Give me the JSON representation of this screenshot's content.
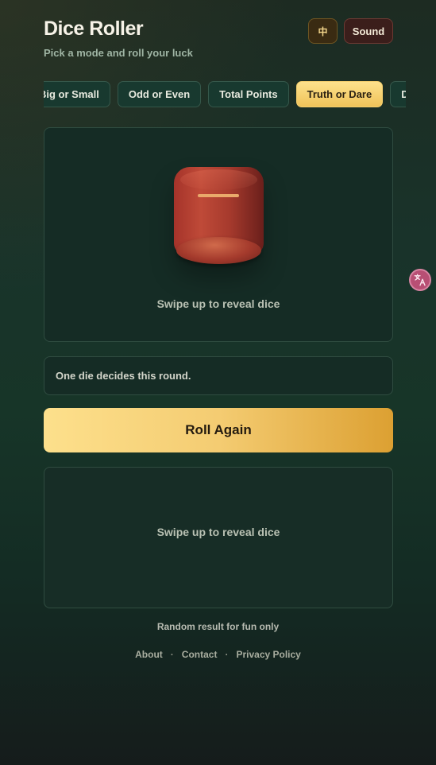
{
  "header": {
    "title": "Dice Roller",
    "subtitle": "Pick a mode and roll your luck",
    "language_label": "中",
    "sound_label": "Sound"
  },
  "modes": [
    {
      "label": "Big or Small",
      "active": false
    },
    {
      "label": "Odd or Even",
      "active": false
    },
    {
      "label": "Total Points",
      "active": false
    },
    {
      "label": "Truth or Dare",
      "active": true
    },
    {
      "label": "Dare",
      "active": false
    }
  ],
  "stage": {
    "hint": "Swipe up to reveal dice"
  },
  "info": {
    "text": "One die decides this round."
  },
  "roll_button": {
    "label": "Roll Again"
  },
  "reveal": {
    "hint": "Swipe up to reveal dice"
  },
  "disclaimer": "Random result for fun only",
  "footer": {
    "links": [
      "About",
      "Contact",
      "Privacy Policy"
    ],
    "separator": "·"
  },
  "icons": {
    "cup": "dice-cup-icon",
    "translate": "translate-icon"
  },
  "colors": {
    "accent": "#f4cc72",
    "cup": "#b4402f",
    "panel": "#152c25"
  }
}
